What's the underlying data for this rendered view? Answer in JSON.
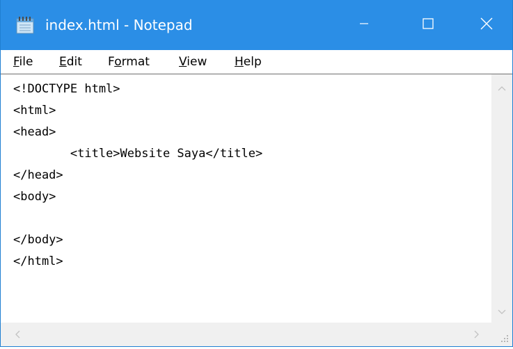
{
  "window": {
    "title": "index.html - Notepad"
  },
  "menu": {
    "file": {
      "mnemonic": "F",
      "rest": "ile"
    },
    "edit": {
      "mnemonic": "E",
      "rest": "dit"
    },
    "format": {
      "before": "F",
      "mnemonic": "o",
      "after": "rmat"
    },
    "view": {
      "mnemonic": "V",
      "rest": "iew"
    },
    "help": {
      "mnemonic": "H",
      "rest": "elp"
    }
  },
  "editor": {
    "content": "<!DOCTYPE html>\n<html>\n<head>\n\t<title>Website Saya</title>\n</head>\n<body>\n\n</body>\n</html>"
  },
  "icons": {
    "app": "notepad-icon",
    "minimize": "minimize-icon",
    "maximize": "maximize-icon",
    "close": "close-icon"
  },
  "colors": {
    "titlebar": "#2b8ee6",
    "scrollbar": "#f0f0f0"
  }
}
